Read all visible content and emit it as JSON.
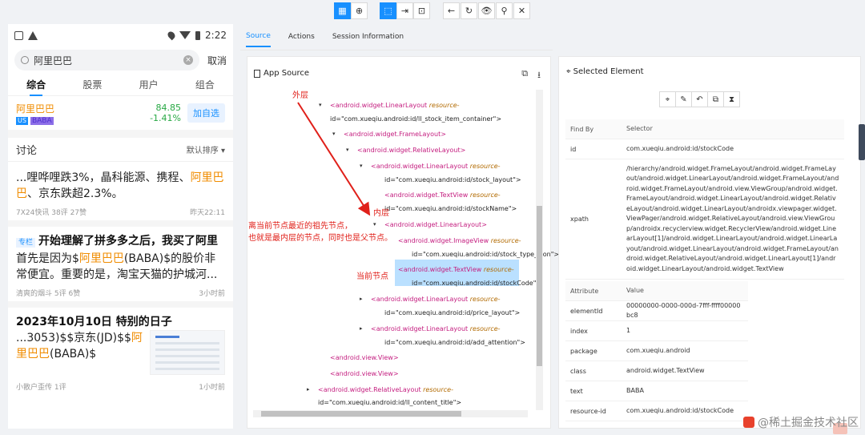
{
  "toolbar": {
    "buttons": [
      "▦",
      "⊕",
      "⬚",
      "⇥",
      "⊡",
      "←",
      "↻",
      "👁",
      "⚲",
      "✕"
    ]
  },
  "phone": {
    "status": {
      "time": "2:22"
    },
    "search": {
      "value": "阿里巴巴",
      "cancel": "取消"
    },
    "tabs": [
      "综合",
      "股票",
      "用户",
      "组合"
    ],
    "stock": {
      "name": "阿里巴巴",
      "market": "US",
      "code": "BABA",
      "price": "84.85",
      "change": "-1.41%",
      "add_label": "加自选"
    },
    "discussion": {
      "title": "讨论",
      "sort": "默认排序"
    },
    "posts": [
      {
        "text_a": "...哩哗哩跌3%，晶科能源、携程、",
        "hl_a": "阿里巴",
        "hl_b": "巴",
        "text_b": "、京东跌超2.3%。",
        "source": "7X24快讯",
        "views": "38评",
        "likes": "27赞",
        "time": "昨天22:11"
      },
      {
        "tag": "专栏",
        "title": "开始理解了拼多多之后，我买了阿里",
        "text_a": "首先是因为$",
        "hl_a": "阿里巴巴",
        "text_b": "(BABA)$的股价非常便宜。重要的是，淘宝天猫的护城河...",
        "author": "清爽的烟斗",
        "comments": "5评",
        "likes": "6赞",
        "time": "3小时前"
      },
      {
        "title": "2023年10月10日 特别的日子",
        "text_a": "...3053)$$京东(JD)$$",
        "hl_a": "阿里巴巴",
        "text_b": "(BABA)$",
        "author": "小散户歪传",
        "comments": "1评",
        "time": "1小时前"
      }
    ]
  },
  "inspector_tabs": [
    "Source",
    "Actions",
    "Session Information"
  ],
  "source_panel": {
    "title": "App Source",
    "lines": [
      {
        "arrow": "▾",
        "tag": "<android.widget.LinearLayout",
        "attr": " resource-",
        "val": ""
      },
      {
        "arrow": "",
        "tag": "",
        "attr": "",
        "val": "id=\"com.xueqiu.android:id/ll_stock_item_container\">"
      },
      {
        "arrow": "▾",
        "tag": "<android.widget.FrameLayout>",
        "attr": "",
        "val": ""
      },
      {
        "arrow": "▾",
        "tag": "<android.widget.RelativeLayout>",
        "attr": "",
        "val": ""
      },
      {
        "arrow": "▾",
        "tag": "<android.widget.LinearLayout",
        "attr": " resource-",
        "val": ""
      },
      {
        "arrow": "",
        "tag": "",
        "attr": "",
        "val": "id=\"com.xueqiu.android:id/stock_layout\">"
      },
      {
        "arrow": "",
        "tag": "<android.widget.TextView",
        "attr": " resource-",
        "val": ""
      },
      {
        "arrow": "",
        "tag": "",
        "attr": "",
        "val": "id=\"com.xueqiu.android:id/stockName\">"
      },
      {
        "arrow": "▾",
        "tag": "<android.widget.LinearLayout>",
        "attr": "",
        "val": ""
      },
      {
        "arrow": "",
        "tag": "<android.widget.ImageView",
        "attr": " resource-",
        "val": ""
      },
      {
        "arrow": "",
        "tag": "",
        "attr": "",
        "val": "id=\"com.xueqiu.android:id/stock_type_icon\">"
      },
      {
        "arrow": "",
        "tag": "<android.widget.TextView",
        "attr": " resource-",
        "val": ""
      },
      {
        "arrow": "",
        "tag": "",
        "attr": "",
        "val": "id=\"com.xueqiu.android:id/stockCode\">"
      },
      {
        "arrow": "▸",
        "tag": "<android.widget.LinearLayout",
        "attr": " resource-",
        "val": ""
      },
      {
        "arrow": "",
        "tag": "",
        "attr": "",
        "val": "id=\"com.xueqiu.android:id/price_layout\">"
      },
      {
        "arrow": "▸",
        "tag": "<android.widget.LinearLayout",
        "attr": " resource-",
        "val": ""
      },
      {
        "arrow": "",
        "tag": "",
        "attr": "",
        "val": "id=\"com.xueqiu.android:id/add_attention\">"
      },
      {
        "arrow": "",
        "tag": "<android.view.View>",
        "attr": "",
        "val": ""
      },
      {
        "arrow": "",
        "tag": "<android.view.View>",
        "attr": "",
        "val": ""
      },
      {
        "arrow": "▸",
        "tag": "<android.widget.RelativeLayout",
        "attr": " resource-",
        "val": ""
      },
      {
        "arrow": "",
        "tag": "",
        "attr": "",
        "val": "id=\"com.xueqiu.android:id/ll_content_title\">"
      }
    ],
    "annotations": {
      "outer": "外层",
      "inner": "内层",
      "desc_1": "离当前节点最近的祖先节点，",
      "desc_2": "也就是最内层的节点，同时也是父节点。",
      "current": "当前节点"
    }
  },
  "selected_element": {
    "title": "Selected Element",
    "actions": [
      "⌖",
      "✎",
      "↶",
      "⧉",
      "⧗"
    ],
    "find_by_header": [
      "Find By",
      "Selector"
    ],
    "find_by": [
      {
        "key": "id",
        "value": "com.xueqiu.android:id/stockCode"
      },
      {
        "key": "xpath",
        "value": "/hierarchy/android.widget.FrameLayout/android.widget.FrameLayout/android.widget.LinearLayout/android.widget.FrameLayout/android.widget.FrameLayout/android.view.ViewGroup/android.widget.FrameLayout/android.widget.LinearLayout/android.widget.RelativeLayout/android.widget.LinearLayout/androidx.viewpager.widget.ViewPager/android.widget.RelativeLayout/android.view.ViewGroup/androidx.recyclerview.widget.RecyclerView/android.widget.LinearLayout[1]/android.widget.LinearLayout/android.widget.LinearLayout/android.widget.LinearLayout/android.widget.FrameLayout/android.widget.RelativeLayout/android.widget.LinearLayout[1]/android.widget.LinearLayout/android.widget.TextView"
      }
    ],
    "attr_header": [
      "Attribute",
      "Value"
    ],
    "attributes": [
      {
        "key": "elementId",
        "value": "00000000-0000-000d-7fff-ffff00000bc8"
      },
      {
        "key": "index",
        "value": "1"
      },
      {
        "key": "package",
        "value": "com.xueqiu.android"
      },
      {
        "key": "class",
        "value": "android.widget.TextView"
      },
      {
        "key": "text",
        "value": "BABA"
      },
      {
        "key": "resource-id",
        "value": "com.xueqiu.android:id/stockCode"
      }
    ]
  },
  "watermark": "@稀土掘金技术社区"
}
